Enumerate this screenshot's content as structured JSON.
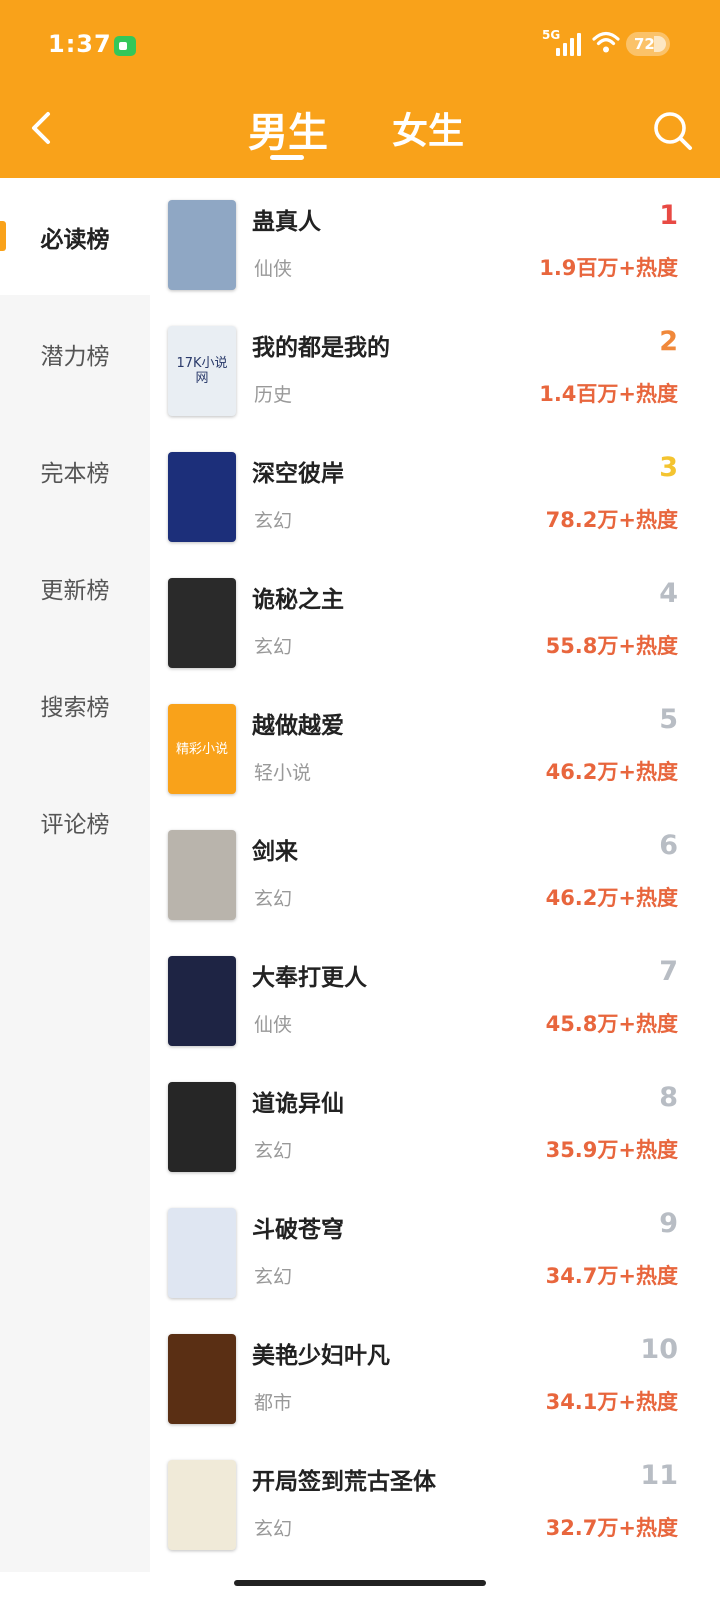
{
  "status_bar": {
    "time": "1:37",
    "network": "5G",
    "battery": "72"
  },
  "header": {
    "tabs": [
      {
        "label": "男生",
        "active": true
      },
      {
        "label": "女生",
        "active": false
      }
    ],
    "icons": {
      "back": "chevron-left-icon",
      "search": "search-icon"
    }
  },
  "sidebar": {
    "items": [
      {
        "label": "必读榜",
        "active": true
      },
      {
        "label": "潜力榜",
        "active": false
      },
      {
        "label": "完本榜",
        "active": false
      },
      {
        "label": "更新榜",
        "active": false
      },
      {
        "label": "搜索榜",
        "active": false
      },
      {
        "label": "评论榜",
        "active": false
      }
    ]
  },
  "books": [
    {
      "rank": "1",
      "title": "蛊真人",
      "genre": "仙侠",
      "heat": "1.9百万+热度",
      "cover_text": "",
      "cover_color": "#8fa7c4"
    },
    {
      "rank": "2",
      "title": "我的都是我的",
      "genre": "历史",
      "heat": "1.4百万+热度",
      "cover_text": "17K小说网",
      "cover_color": "#e9eef3"
    },
    {
      "rank": "3",
      "title": "深空彼岸",
      "genre": "玄幻",
      "heat": "78.2万+热度",
      "cover_text": "",
      "cover_color": "#1c2f7a"
    },
    {
      "rank": "4",
      "title": "诡秘之主",
      "genre": "玄幻",
      "heat": "55.8万+热度",
      "cover_text": "",
      "cover_color": "#2a2a2a"
    },
    {
      "rank": "5",
      "title": "越做越爱",
      "genre": "轻小说",
      "heat": "46.2万+热度",
      "cover_text": "精彩小说",
      "cover_color": "#f9a21a"
    },
    {
      "rank": "6",
      "title": "剑来",
      "genre": "玄幻",
      "heat": "46.2万+热度",
      "cover_text": "",
      "cover_color": "#b9b4ac"
    },
    {
      "rank": "7",
      "title": "大奉打更人",
      "genre": "仙侠",
      "heat": "45.8万+热度",
      "cover_text": "",
      "cover_color": "#1e2444"
    },
    {
      "rank": "8",
      "title": "道诡异仙",
      "genre": "玄幻",
      "heat": "35.9万+热度",
      "cover_text": "",
      "cover_color": "#262626"
    },
    {
      "rank": "9",
      "title": "斗破苍穹",
      "genre": "玄幻",
      "heat": "34.7万+热度",
      "cover_text": "",
      "cover_color": "#dfe6f2"
    },
    {
      "rank": "10",
      "title": "美艳少妇叶凡",
      "genre": "都市",
      "heat": "34.1万+热度",
      "cover_text": "",
      "cover_color": "#5a2f14"
    },
    {
      "rank": "11",
      "title": "开局签到荒古圣体",
      "genre": "玄幻",
      "heat": "32.7万+热度",
      "cover_text": "",
      "cover_color": "#f0ead8"
    }
  ]
}
